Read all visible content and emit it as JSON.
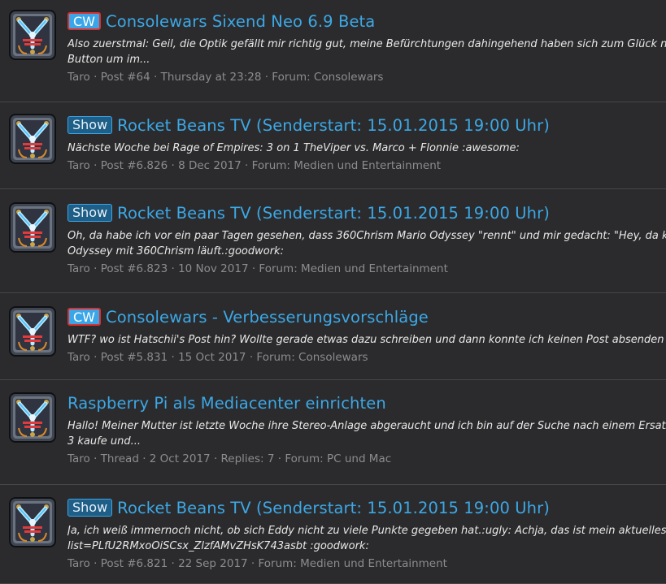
{
  "results": [
    {
      "prefix": "CW",
      "prefix_style": "cw",
      "title": "Consolewars Sixend Neo 6.9 Beta",
      "snippet_lines": [
        "Also zuerstmal: Geil, die Optik gefällt mir richtig gut, meine Befürchtungen dahingehend haben sich zum Glück nicht",
        "Button um im..."
      ],
      "meta": {
        "author": "Taro",
        "kind": "Post #64",
        "date": "Thursday at 23:28",
        "extra": "",
        "forum": "Forum: Consolewars"
      }
    },
    {
      "prefix": "Show",
      "prefix_style": "show",
      "title": "Rocket Beans TV (Senderstart: 15.01.2015 19:00 Uhr)",
      "snippet_lines": [
        "Nächste Woche bei Rage of Empires: 3 on 1 TheViper vs. Marco + Flonnie :awesome:"
      ],
      "meta": {
        "author": "Taro",
        "kind": "Post #6.826",
        "date": "8 Dec 2017",
        "extra": "",
        "forum": "Forum: Medien und Entertainment"
      }
    },
    {
      "prefix": "Show",
      "prefix_style": "show",
      "title": "Rocket Beans TV (Senderstart: 15.01.2015 19:00 Uhr)",
      "snippet_lines": [
        "Oh, da habe ich vor ein paar Tagen gesehen, dass 360Chrism Mario Odyssey \"rennt\" und mir gedacht: \"Hey, da könnt",
        "Odyssey mit 360Chrism läuft.:goodwork:"
      ],
      "meta": {
        "author": "Taro",
        "kind": "Post #6.823",
        "date": "10 Nov 2017",
        "extra": "",
        "forum": "Forum: Medien und Entertainment"
      }
    },
    {
      "prefix": "CW",
      "prefix_style": "cw",
      "title": "Consolewars - Verbesserungsvorschläge",
      "snippet_lines": [
        "WTF? wo ist Hatschii's Post hin? Wollte gerade etwas dazu schreiben und dann konnte ich keinen Post absenden und"
      ],
      "meta": {
        "author": "Taro",
        "kind": "Post #5.831",
        "date": "15 Oct 2017",
        "extra": "",
        "forum": "Forum: Consolewars"
      }
    },
    {
      "prefix": "",
      "prefix_style": "",
      "title": "Raspberry Pi als Mediacenter einrichten",
      "snippet_lines": [
        "Hallo! Meiner Mutter ist letzte Woche ihre Stereo-Anlage abgeraucht und ich bin auf der Suche nach einem Ersatz für",
        "3 kaufe und..."
      ],
      "meta": {
        "author": "Taro",
        "kind": "Thread",
        "date": "2 Oct 2017",
        "extra": "Replies: 7",
        "forum": "Forum: PC und Mac"
      }
    },
    {
      "prefix": "Show",
      "prefix_style": "show",
      "title": "Rocket Beans TV (Senderstart: 15.01.2015 19:00 Uhr)",
      "snippet_lines": [
        "Ja, ich weiß immernoch nicht, ob sich Eddy nicht zu viele Punkte gegeben hat.:ugly: Achja, das ist mein aktuelles Lieb",
        "list=PLfU2RMxoOiSCsx_ZlzfAMvZHsK743asbt :goodwork:"
      ],
      "meta": {
        "author": "Taro",
        "kind": "Post #6.821",
        "date": "22 Sep 2017",
        "extra": "",
        "forum": "Forum: Medien und Entertainment"
      }
    }
  ],
  "separator": " · ",
  "colors": {
    "background": "#2b2b2d",
    "link": "#3ca8e6",
    "meta": "#8c8c90",
    "cw_prefix_bg": "#3aa6e8",
    "cw_prefix_border": "#d9322f",
    "show_prefix_bg": "#1f5e86"
  },
  "avatar_icon": "flux-capacitor-icon"
}
